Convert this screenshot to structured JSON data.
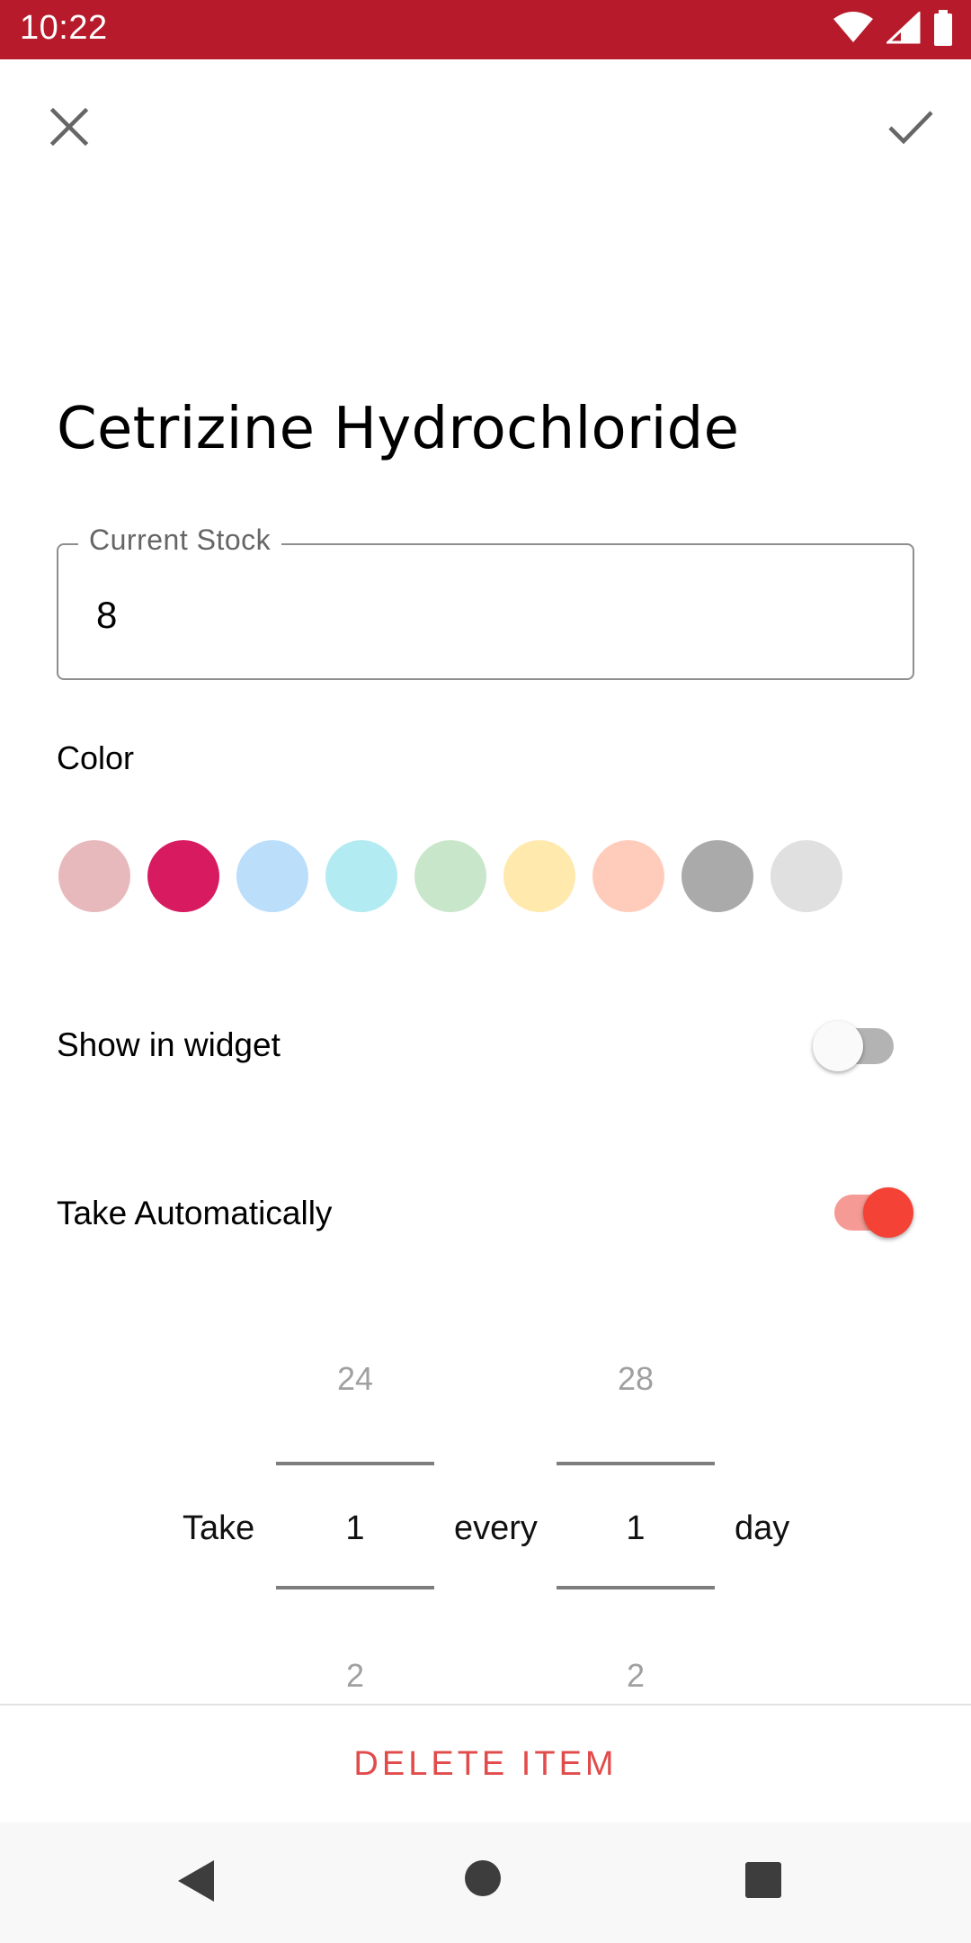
{
  "status_bar": {
    "time": "10:22",
    "icons": [
      "wifi-icon",
      "cellular-signal-icon",
      "battery-icon"
    ],
    "background": "#B71B2B"
  },
  "toolbar": {
    "close_icon": "close-icon",
    "confirm_icon": "check-icon"
  },
  "item": {
    "title": "Cetrizine Hydrochloride"
  },
  "stock_field": {
    "label": "Current Stock",
    "value": "8"
  },
  "color_section": {
    "heading": "Color",
    "swatches": [
      "#E8B9BC",
      "#D81B60",
      "#BBDEFB",
      "#B2EBF2",
      "#C8E6C9",
      "#FFE9AD",
      "#FFCCBC",
      "#AAAAAA",
      "#E0E0E0"
    ]
  },
  "show_in_widget": {
    "label": "Show in widget",
    "checked": false
  },
  "take_automatically": {
    "label": "Take Automatically",
    "checked": true,
    "accent": "#F44336"
  },
  "schedule": {
    "take_label": "Take",
    "every_label": "every",
    "unit_label": "day",
    "dose_picker": {
      "previous": "24",
      "value": "1",
      "next": "2"
    },
    "interval_picker": {
      "previous": "28",
      "value": "1",
      "next": "2"
    }
  },
  "actions": {
    "delete_label": "DELETE ITEM",
    "delete_color": "#E24B4B"
  },
  "nav_bar": {
    "icons": [
      "back-icon",
      "home-icon",
      "recents-icon"
    ]
  }
}
